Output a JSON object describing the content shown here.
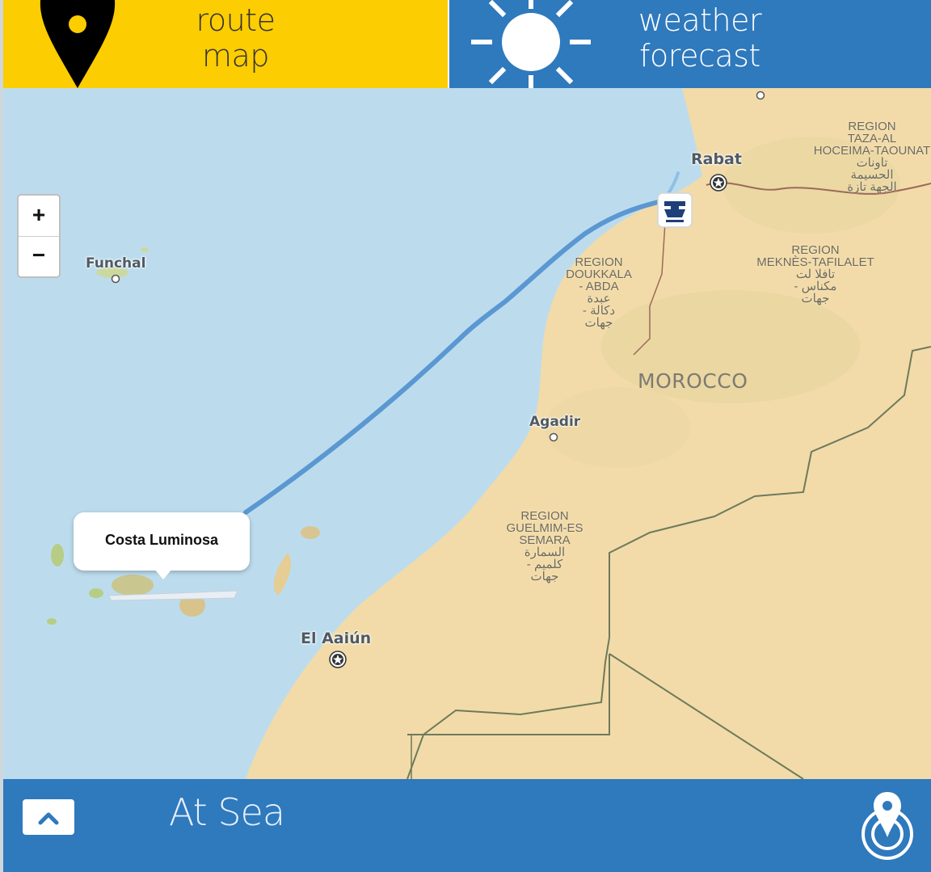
{
  "header": {
    "route_tab": {
      "line1": "route",
      "line2": "map",
      "icon": "map-pin-icon",
      "color": "#fccd00"
    },
    "weather_tab": {
      "line1": "weather",
      "line2": "forecast",
      "icon": "sun-icon",
      "color": "#2f79bd"
    }
  },
  "map": {
    "places": {
      "funchal": "Funchal",
      "rabat": "Rabat",
      "agadir": "Agadir",
      "el_aaiun": "El Aaiún"
    },
    "regions": {
      "taza": "REGION\nTAZA-AL\nHOCEIMA-TAOUNAT\nتاونات\nالحسيمة\nالجهة تازة",
      "doukkala": "REGION\nDOUKKALA\n- ABDA\nعبدة\n- دكالة\nجهات",
      "meknes": "REGION\nMEKNÈS-TAFILALET\nتافلا لت\n- مكناس\nجهات",
      "guelmim": "REGION\nGUELMIM-ES\nSEMARA\nالسمارة\n- كلميم\nجهات"
    },
    "country": "MOROCCO",
    "zoom_in": "+",
    "zoom_out": "−",
    "ship_popup": "Costa Luminosa",
    "port_marker_icon": "anchor-icon"
  },
  "footer": {
    "status": "At Sea",
    "expand_icon": "chevron-up-icon",
    "locate_icon": "location-target-icon",
    "color": "#2f79bd"
  }
}
